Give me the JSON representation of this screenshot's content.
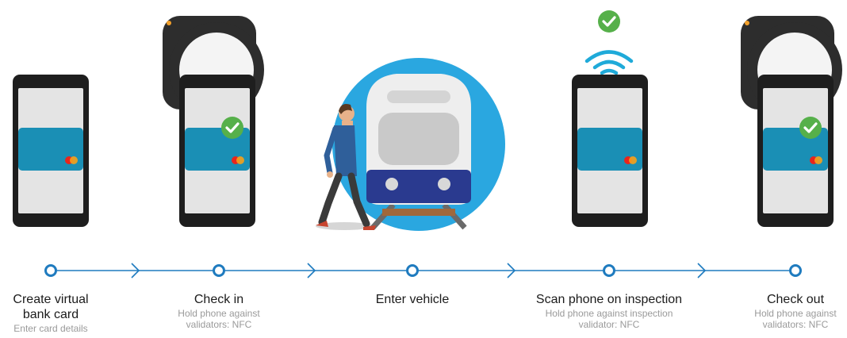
{
  "colors": {
    "phone_body": "#1e1e1e",
    "phone_screen": "#e4e4e4",
    "card": "#1a8fb5",
    "check_green": "#56b04a",
    "timeline_blue": "#1f7bbf",
    "validator": "#2d2d2d",
    "train_circle": "#2aa7e0",
    "train_navy": "#2a3a8f",
    "nfc_waves": "#1faad9"
  },
  "steps": [
    {
      "title": "Create virtual\nbank card",
      "subtitle": "Enter card details",
      "icon": "phone-card-icon"
    },
    {
      "title": "Check in",
      "subtitle": "Hold phone against\nvalidators: NFC",
      "icon": "validator-phone-icon"
    },
    {
      "title": "Enter vehicle",
      "subtitle": "",
      "icon": "train-icon"
    },
    {
      "title": "Scan phone on inspection",
      "subtitle": "Hold phone against inspection\nvalidator: NFC",
      "icon": "nfc-scan-icon"
    },
    {
      "title": "Check out",
      "subtitle": "Hold phone against\nvalidators: NFC",
      "icon": "validator-phone-icon"
    }
  ]
}
